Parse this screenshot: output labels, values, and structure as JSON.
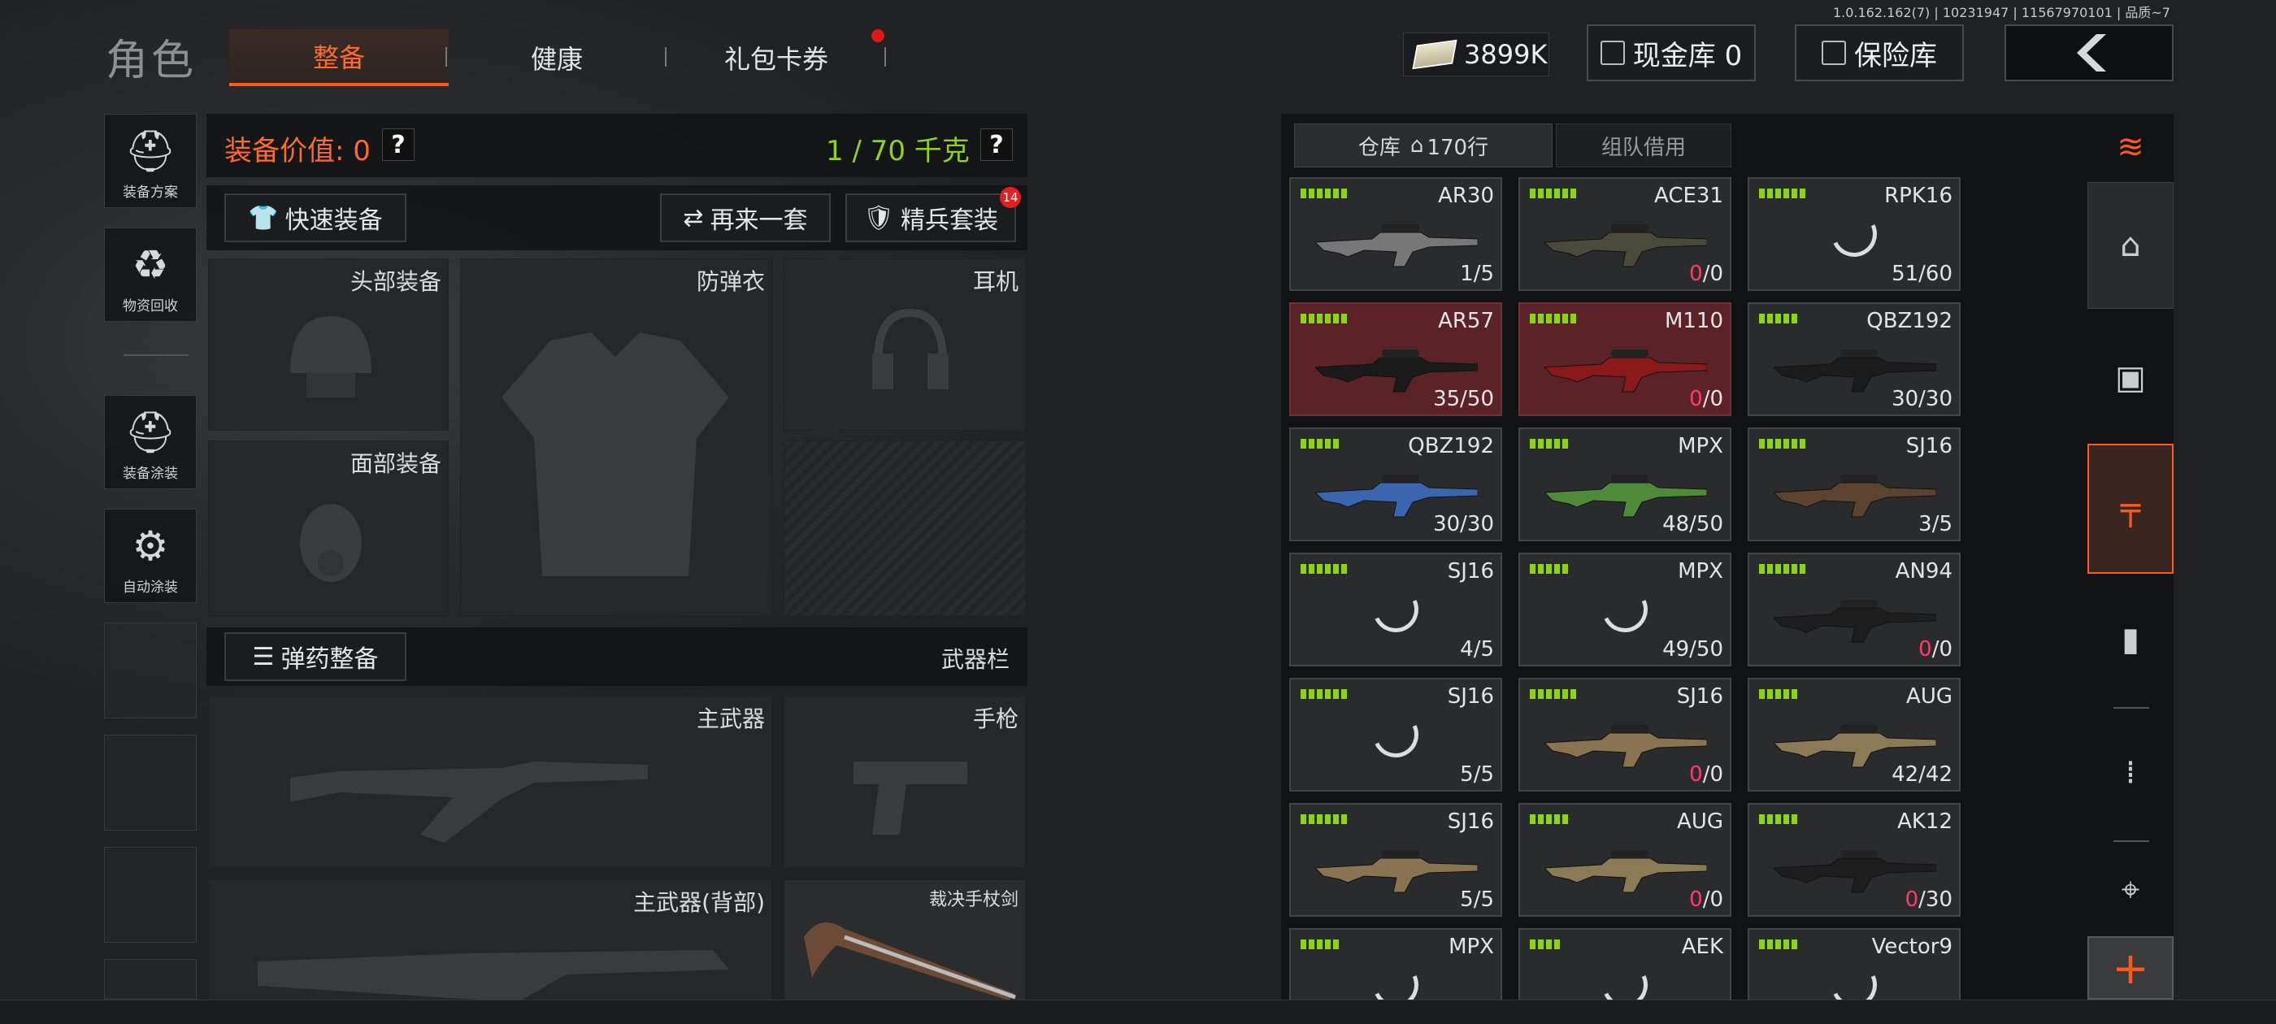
{
  "version": "1.0.162.162(7) | 10231947 | 11567970101 | 品质~7",
  "header": {
    "title": "角色",
    "tabs": [
      "整备",
      "健康",
      "礼包卡券"
    ],
    "money": "3899K",
    "cash_vault": "现金库 0",
    "safe": "保险库"
  },
  "sidebar": {
    "items": [
      "装备方案",
      "物资回收",
      "装备涂装",
      "自动涂装"
    ]
  },
  "equip": {
    "value_label": "装备价值: 0",
    "weight": "1 / 70 千克",
    "quick": "快速装备",
    "again": "再来一套",
    "elite": "精兵套装",
    "elite_badge": "14",
    "slots": {
      "head": "头部装备",
      "armor": "防弹衣",
      "headset": "耳机",
      "face": "面部装备"
    },
    "ammo_btn": "弹药整备",
    "weapon_bar": "武器栏",
    "main": "主武器",
    "pistol": "手枪",
    "main_back": "主武器(背部)",
    "melee": "裁决手杖剑"
  },
  "storage": {
    "tab_warehouse": "仓库",
    "tab_rows": "170行",
    "tab_team": "组队借用",
    "items": [
      {
        "name": "AR30",
        "count": "1/5",
        "zero": false,
        "bars": 6,
        "red": false,
        "gun": true,
        "color": "#777"
      },
      {
        "name": "ACE31",
        "count": "0/0",
        "zero": true,
        "bars": 6,
        "red": false,
        "gun": true,
        "color": "#4a4a3a"
      },
      {
        "name": "RPK16",
        "count": "51/60",
        "zero": false,
        "bars": 6,
        "red": false,
        "gun": false
      },
      {
        "name": "AR57",
        "count": "35/50",
        "zero": false,
        "bars": 6,
        "red": true,
        "gun": true,
        "color": "#1a1a1a"
      },
      {
        "name": "M110",
        "count": "0/0",
        "zero": true,
        "bars": 6,
        "red": true,
        "gun": true,
        "color": "#8a1a1a"
      },
      {
        "name": "QBZ192",
        "count": "30/30",
        "zero": false,
        "bars": 5,
        "red": false,
        "gun": true,
        "color": "#1c1c1c"
      },
      {
        "name": "QBZ192",
        "count": "30/30",
        "zero": false,
        "bars": 5,
        "red": false,
        "gun": true,
        "color": "#3a66b0"
      },
      {
        "name": "MPX",
        "count": "48/50",
        "zero": false,
        "bars": 5,
        "red": false,
        "gun": true,
        "color": "#4f8a3a"
      },
      {
        "name": "SJ16",
        "count": "3/5",
        "zero": false,
        "bars": 6,
        "red": false,
        "gun": true,
        "color": "#5b4330"
      },
      {
        "name": "SJ16",
        "count": "4/5",
        "zero": false,
        "bars": 6,
        "red": false,
        "gun": false
      },
      {
        "name": "MPX",
        "count": "49/50",
        "zero": false,
        "bars": 5,
        "red": false,
        "gun": false
      },
      {
        "name": "AN94",
        "count": "0/0",
        "zero": true,
        "bars": 6,
        "red": false,
        "gun": true,
        "color": "#1e1e1e"
      },
      {
        "name": "SJ16",
        "count": "5/5",
        "zero": false,
        "bars": 6,
        "red": false,
        "gun": false
      },
      {
        "name": "SJ16",
        "count": "0/0",
        "zero": true,
        "bars": 6,
        "red": false,
        "gun": true,
        "color": "#8a7350"
      },
      {
        "name": "AUG",
        "count": "42/42",
        "zero": false,
        "bars": 5,
        "red": false,
        "gun": true,
        "color": "#8a7a55"
      },
      {
        "name": "SJ16",
        "count": "5/5",
        "zero": false,
        "bars": 6,
        "red": false,
        "gun": true,
        "color": "#8a7350"
      },
      {
        "name": "AUG",
        "count": "0/0",
        "zero": true,
        "bars": 5,
        "red": false,
        "gun": true,
        "color": "#8a7a55"
      },
      {
        "name": "AK12",
        "count": "0/30",
        "zero": true,
        "bars": 5,
        "red": false,
        "gun": true,
        "color": "#1e1e1e"
      },
      {
        "name": "MPX",
        "count": "",
        "zero": false,
        "bars": 5,
        "red": false,
        "gun": false
      },
      {
        "name": "AEK",
        "count": "",
        "zero": false,
        "bars": 4,
        "red": false,
        "gun": false
      },
      {
        "name": "Vector9",
        "count": "",
        "zero": false,
        "bars": 5,
        "red": false,
        "gun": false
      }
    ]
  },
  "categories": [
    "layers-refresh-icon",
    "home-icon",
    "vest-icon",
    "rifle-icon",
    "magazine-icon",
    "bullet-icon",
    "attachment-icon",
    "plus-icon"
  ]
}
